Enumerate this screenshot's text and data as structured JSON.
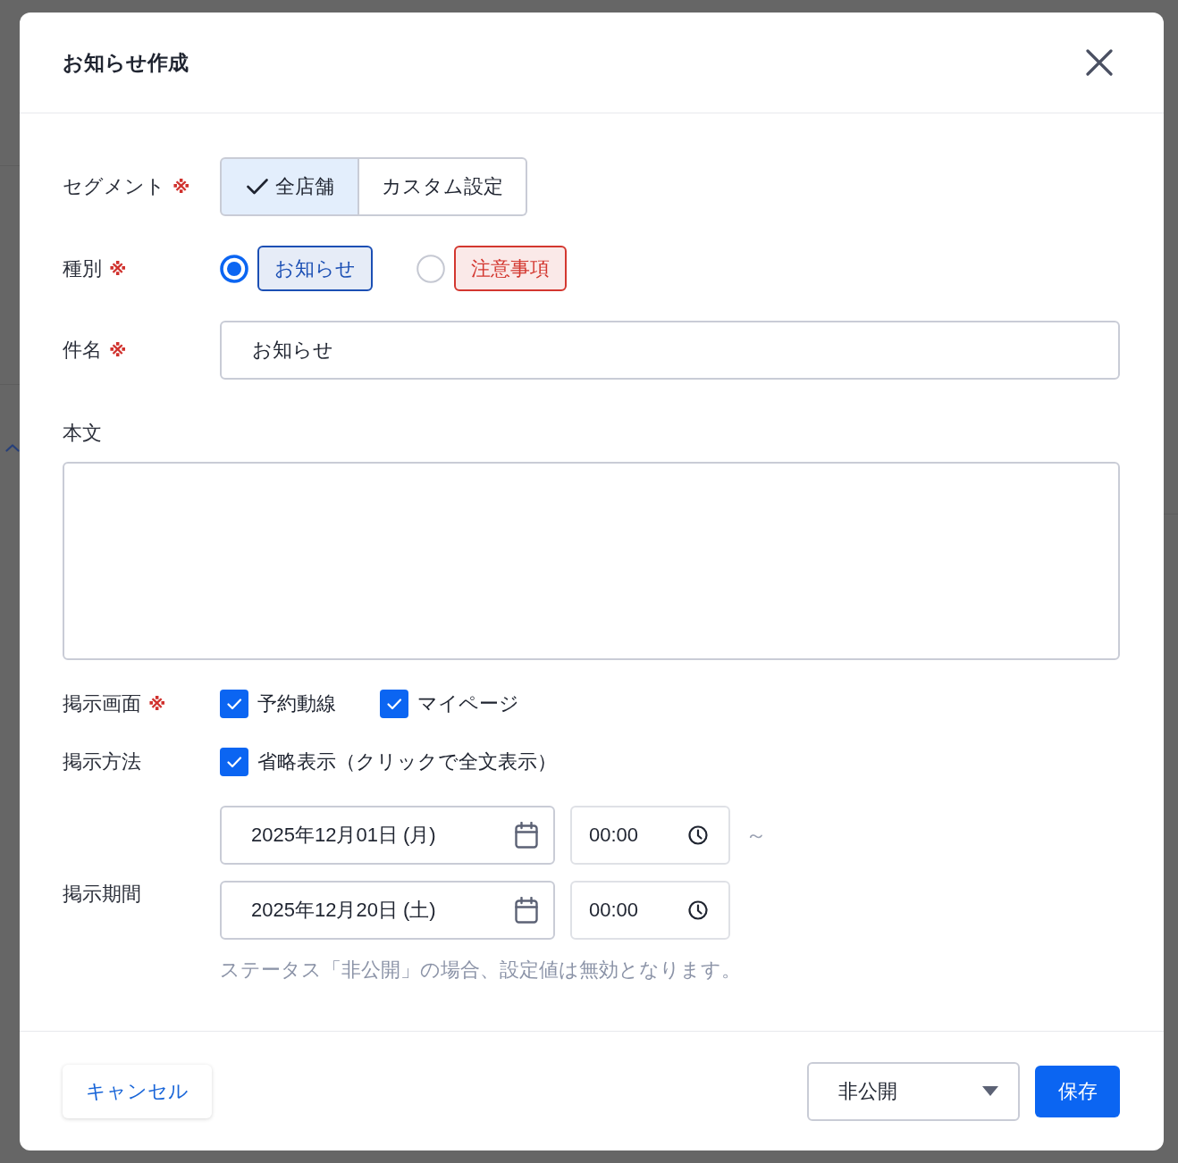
{
  "dialog": {
    "title": "お知らせ作成"
  },
  "form": {
    "segment": {
      "label": "セグメント",
      "required_mark": "※",
      "options": [
        {
          "label": "全店舗",
          "selected": true
        },
        {
          "label": "カスタム設定",
          "selected": false
        }
      ]
    },
    "type": {
      "label": "種別",
      "required_mark": "※",
      "options": [
        {
          "label": "お知らせ",
          "selected": true,
          "color": "#1b4fb4"
        },
        {
          "label": "注意事項",
          "selected": false,
          "color": "#d3372f"
        }
      ]
    },
    "subject": {
      "label": "件名",
      "required_mark": "※",
      "value": "お知らせ"
    },
    "body": {
      "label": "本文"
    },
    "display_screens": {
      "label": "掲示画面",
      "required_mark": "※",
      "options": [
        {
          "label": "予約動線",
          "checked": true
        },
        {
          "label": "マイページ",
          "checked": true
        }
      ]
    },
    "display_method": {
      "label": "掲示方法",
      "options": [
        {
          "label": "省略表示（クリックで全文表示）",
          "checked": true
        }
      ]
    },
    "display_period": {
      "label": "掲示期間",
      "separator": "～",
      "start": {
        "date": "2025年12月01日 (月)",
        "time": "00:00"
      },
      "end": {
        "date": "2025年12月20日 (土)",
        "time": "00:00"
      },
      "hint": "ステータス「非公開」の場合、設定値は無効となります。"
    }
  },
  "footer": {
    "cancel_button": "キャンセル",
    "status_select": {
      "value": "非公開"
    },
    "save_button": "保存"
  }
}
